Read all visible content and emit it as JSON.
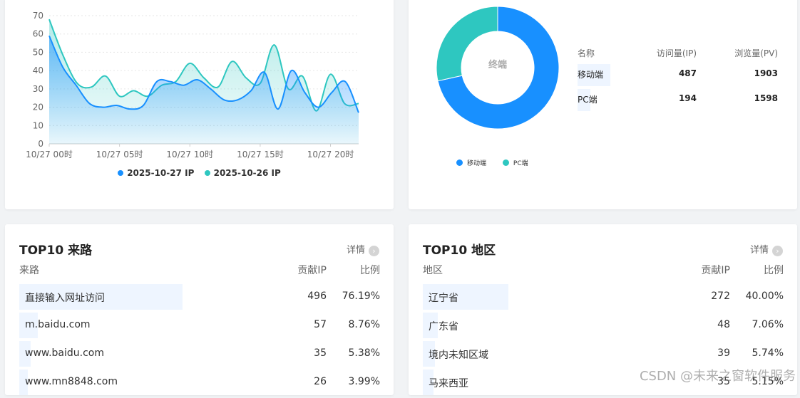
{
  "trend": {
    "chart_data": {
      "type": "line",
      "x": [
        "10/27 00时",
        "10/27 01时",
        "10/27 02时",
        "10/27 03时",
        "10/27 04时",
        "10/27 05时",
        "10/27 06时",
        "10/27 07时",
        "10/27 08时",
        "10/27 09时",
        "10/27 10时",
        "10/27 11时",
        "10/27 12时",
        "10/27 13时",
        "10/27 14时",
        "10/27 15时",
        "10/27 16时",
        "10/27 17时",
        "10/27 18时",
        "10/27 19时",
        "10/27 20时",
        "10/27 21时",
        "10/27 22时"
      ],
      "x_tick_labels": [
        "10/27 00时",
        "10/27 05时",
        "10/27 10时",
        "10/27 15时",
        "10/27 20时"
      ],
      "y_ticks": [
        0,
        10,
        20,
        30,
        40,
        50,
        60,
        70
      ],
      "ylim": [
        0,
        70
      ],
      "series": [
        {
          "name": "2025-10-27 IP",
          "color": "#1890ff",
          "values": [
            59,
            42,
            32,
            22,
            20,
            21,
            19,
            21,
            34,
            34,
            32,
            35,
            30,
            24,
            24,
            29,
            39,
            19,
            40,
            28,
            20,
            28,
            34,
            17
          ]
        },
        {
          "name": "2025-10-26 IP",
          "color": "#2ec7c0",
          "values": [
            68,
            48,
            33,
            31,
            37,
            26,
            29,
            26,
            32,
            34,
            44,
            36,
            31,
            45,
            36,
            33,
            54,
            30,
            37,
            18,
            38,
            22,
            22
          ]
        }
      ]
    }
  },
  "terminal": {
    "chart_data": {
      "type": "pie",
      "center_label": "终端",
      "slices": [
        {
          "name": "移动端",
          "value": 487,
          "color": "#1890ff"
        },
        {
          "name": "PC端",
          "value": 194,
          "color": "#2ec7c0"
        }
      ]
    },
    "legend": [
      {
        "label": "移动端",
        "color": "#1890ff"
      },
      {
        "label": "PC端",
        "color": "#2ec7c0"
      }
    ],
    "table": {
      "headers": [
        "名称",
        "访问量(IP)",
        "浏览量(PV)"
      ],
      "rows": [
        {
          "name": "移动端",
          "ip": "487",
          "pv": "1903",
          "share": 0.715
        },
        {
          "name": "PC端",
          "ip": "194",
          "pv": "1598",
          "share": 0.285
        }
      ]
    }
  },
  "source": {
    "title": "TOP10 来路",
    "detail": "详情",
    "headers": [
      "来路",
      "贡献IP",
      "比例"
    ],
    "rows": [
      {
        "label": "直接输入网址访问",
        "ip": "496",
        "ratio": "76.19%",
        "share": 0.7619
      },
      {
        "label": "m.baidu.com",
        "ip": "57",
        "ratio": "8.76%",
        "share": 0.0876
      },
      {
        "label": "www.baidu.com",
        "ip": "35",
        "ratio": "5.38%",
        "share": 0.0538
      },
      {
        "label": "www.mn8848.com",
        "ip": "26",
        "ratio": "3.99%",
        "share": 0.0399
      }
    ]
  },
  "region": {
    "title": "TOP10 地区",
    "detail": "详情",
    "headers": [
      "地区",
      "贡献IP",
      "比例"
    ],
    "rows": [
      {
        "label": "辽宁省",
        "ip": "272",
        "ratio": "40.00%",
        "share": 0.4
      },
      {
        "label": "广东省",
        "ip": "48",
        "ratio": "7.06%",
        "share": 0.0706
      },
      {
        "label": "境内未知区域",
        "ip": "39",
        "ratio": "5.74%",
        "share": 0.0574
      },
      {
        "label": "马来西亚",
        "ip": "35",
        "ratio": "5.15%",
        "share": 0.0515
      }
    ]
  },
  "watermark": "CSDN @未来之窗软件服务"
}
